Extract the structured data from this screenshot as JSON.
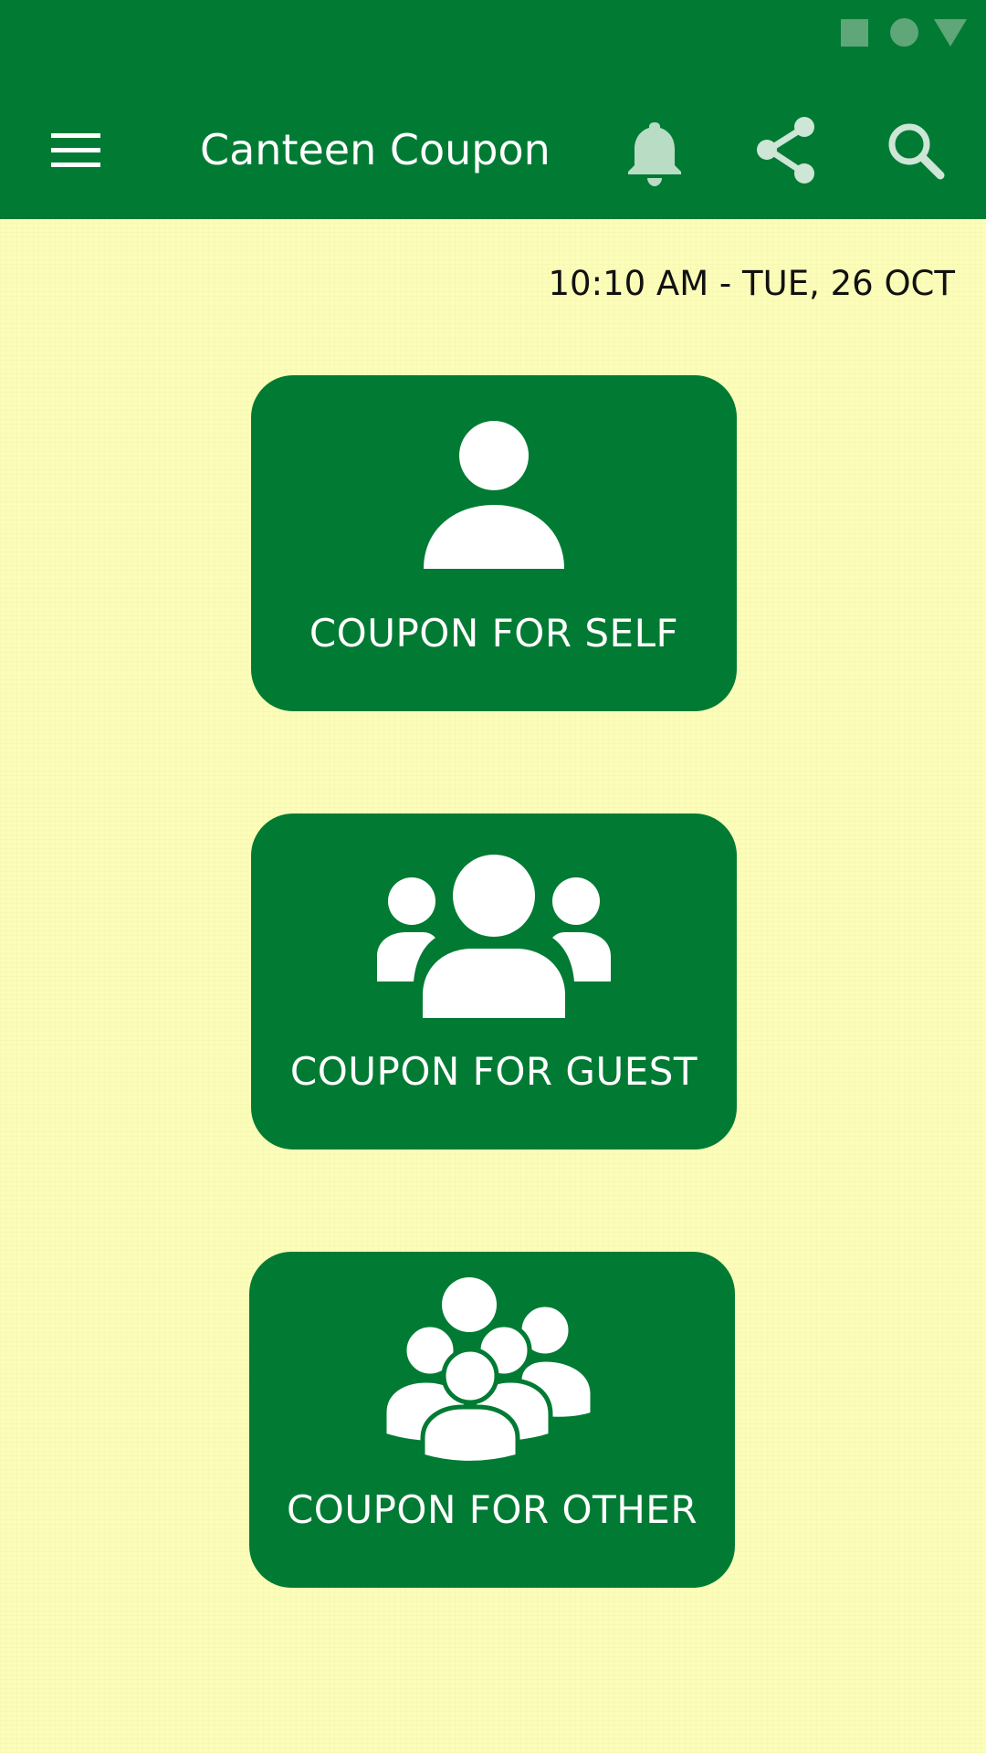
{
  "status_bar": {
    "icons": [
      "square-icon",
      "circle-icon",
      "triangle-icon"
    ]
  },
  "app_bar": {
    "title": "Canteen Coupon",
    "icons": [
      "menu-icon",
      "bell-icon",
      "share-icon",
      "search-icon"
    ]
  },
  "datetime": "10:10 AM - TUE, 26 OCT",
  "cards": [
    {
      "label": "COUPON FOR SELF",
      "icon": "person-icon"
    },
    {
      "label": "COUPON FOR GUEST",
      "icon": "group-icon"
    },
    {
      "label": "COUPON FOR OTHER",
      "icon": "people-group-icon"
    }
  ],
  "colors": {
    "primary": "#017b33",
    "background": "#fcfdb8",
    "status_icon": "#5fa679",
    "bell_icon": "#b9dcc5",
    "share_search_icon": "#cde6d6",
    "card_text": "#ffffff"
  }
}
